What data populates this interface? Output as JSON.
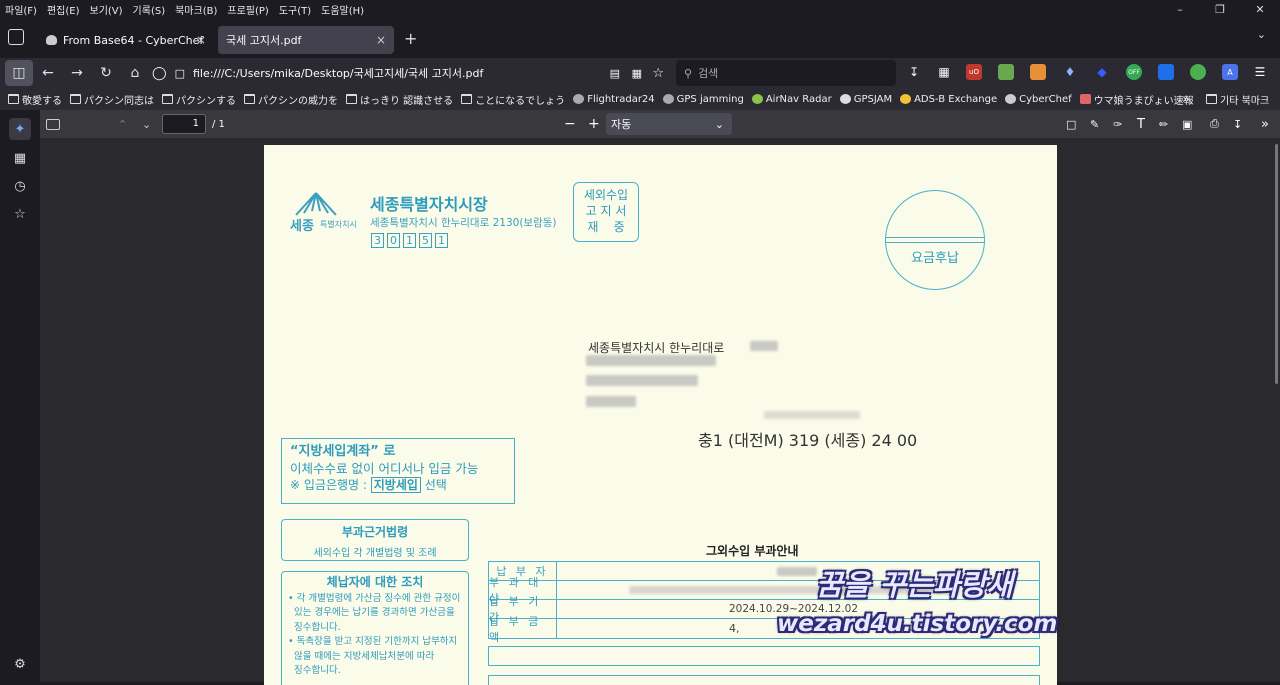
{
  "menu": [
    "파일(F)",
    "편집(E)",
    "보기(V)",
    "기록(S)",
    "북마크(B)",
    "프로필(P)",
    "도구(T)",
    "도움말(H)"
  ],
  "tabs": [
    {
      "title": "From Base64 - CyberChef",
      "close": "×"
    },
    {
      "title": "국세 고지서.pdf",
      "close": "×"
    }
  ],
  "new_tab": "+",
  "url": "file:///C:/Users/mika/Desktop/국세고지세/국세 고지서.pdf",
  "search_placeholder": "검색",
  "bookmarks": [
    {
      "label": "敬愛する",
      "icon": "folder"
    },
    {
      "label": "パクシン同志は",
      "icon": "folder"
    },
    {
      "label": "パクシンする",
      "icon": "folder"
    },
    {
      "label": "パクシンの威力を",
      "icon": "folder"
    },
    {
      "label": "はっきり 認識させる",
      "icon": "folder"
    },
    {
      "label": "ことになるでしょう",
      "icon": "folder"
    },
    {
      "label": "Flightradar24",
      "icon": "site"
    },
    {
      "label": "GPS jamming",
      "icon": "site"
    },
    {
      "label": "AirNav Radar",
      "icon": "site"
    },
    {
      "label": "GPSJAM",
      "icon": "site"
    },
    {
      "label": "ADS-B Exchange",
      "icon": "site"
    },
    {
      "label": "CyberChef",
      "icon": "site"
    },
    {
      "label": "ウマ娘うまぴょい速報",
      "icon": "site"
    }
  ],
  "bookmarks_more": "»",
  "other_bookmarks": "기타 북마크",
  "pdf": {
    "page_number": "1",
    "page_total": "/ 1",
    "zoom": "자동"
  },
  "document": {
    "logo_text": "세종",
    "logo_sub": "특별자치시",
    "issuer": "세종특별자치시장",
    "issuer_addr": "세종특별자치시 한누리대로 2130(보람동)",
    "postal": [
      "3",
      "0",
      "1",
      "5",
      "1"
    ],
    "notice_type": [
      "세외수입",
      "고 지 서",
      "재    중"
    ],
    "postage": "요금후납",
    "recipient_addr": "세종특별자치시 한누리대로",
    "route_code": "충1 (대전M) 319 (세종) 24 00",
    "account_box": [
      "“지방세입계좌” 로",
      "이체수수료 없이 어디서나 입금 가능",
      "※ 입금은행명 :",
      "지방세입",
      "선택"
    ],
    "law_title": "부과근거법령",
    "law_body": "세외수입 각 개별법령 및 조례",
    "action_title": "체납자에 대한 조치",
    "action_body": [
      "• 각 개별법령에 가산금 징수에 관한 규정이",
      "  있는 경우에는 납기를 경과하면 가산금을",
      "  징수합니다.",
      "• 독촉장을 받고 지정된 기한까지 납부하지",
      "  않을 때에는 지방세체납처분에 따라",
      "  징수합니다."
    ],
    "table_title": "그외수입 부과안내",
    "table_rows": [
      {
        "label": "납 부 자",
        "value": ""
      },
      {
        "label": "부 과 대 상",
        "value": ""
      },
      {
        "label": "납 부 기 간",
        "value": "2024.10.29~2024.12.02"
      },
      {
        "label": "납 부 금 액",
        "value": "4,"
      }
    ]
  },
  "watermark": {
    "line1": "꿈을 꾸는파랑새",
    "line2": "wezard4u.tistory.com"
  }
}
